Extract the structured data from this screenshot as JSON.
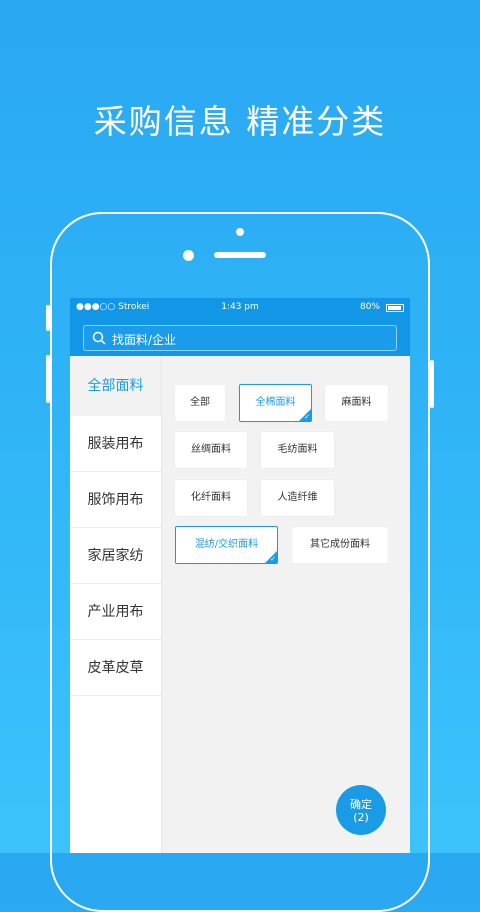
{
  "headline": "采购信息  精准分类",
  "status_bar": {
    "carrier": "●●●○○ Strokei",
    "time": "1:43 pm",
    "battery": "80%"
  },
  "search": {
    "placeholder": "找面料/企业"
  },
  "sidebar": {
    "items": [
      {
        "label": "全部面料",
        "active": true
      },
      {
        "label": "服装用布"
      },
      {
        "label": "服饰用布"
      },
      {
        "label": "家居家纺"
      },
      {
        "label": "产业用布"
      },
      {
        "label": "皮革皮草"
      }
    ]
  },
  "chips": [
    {
      "label": "全部"
    },
    {
      "label": "全棉面料",
      "selected": true
    },
    {
      "label": "麻面料"
    },
    {
      "label": "丝绸面料"
    },
    {
      "label": "毛纺面料"
    },
    {
      "label": "化纤面料"
    },
    {
      "label": "人造纤维"
    },
    {
      "label": "混纺/交织面料",
      "selected": true
    },
    {
      "label": "其它成份面料"
    }
  ],
  "confirm": {
    "label": "确定",
    "count": "(2)"
  },
  "colors": {
    "background": "#2fb3f6",
    "accent": "#1a9be6",
    "header": "#1296e6"
  }
}
